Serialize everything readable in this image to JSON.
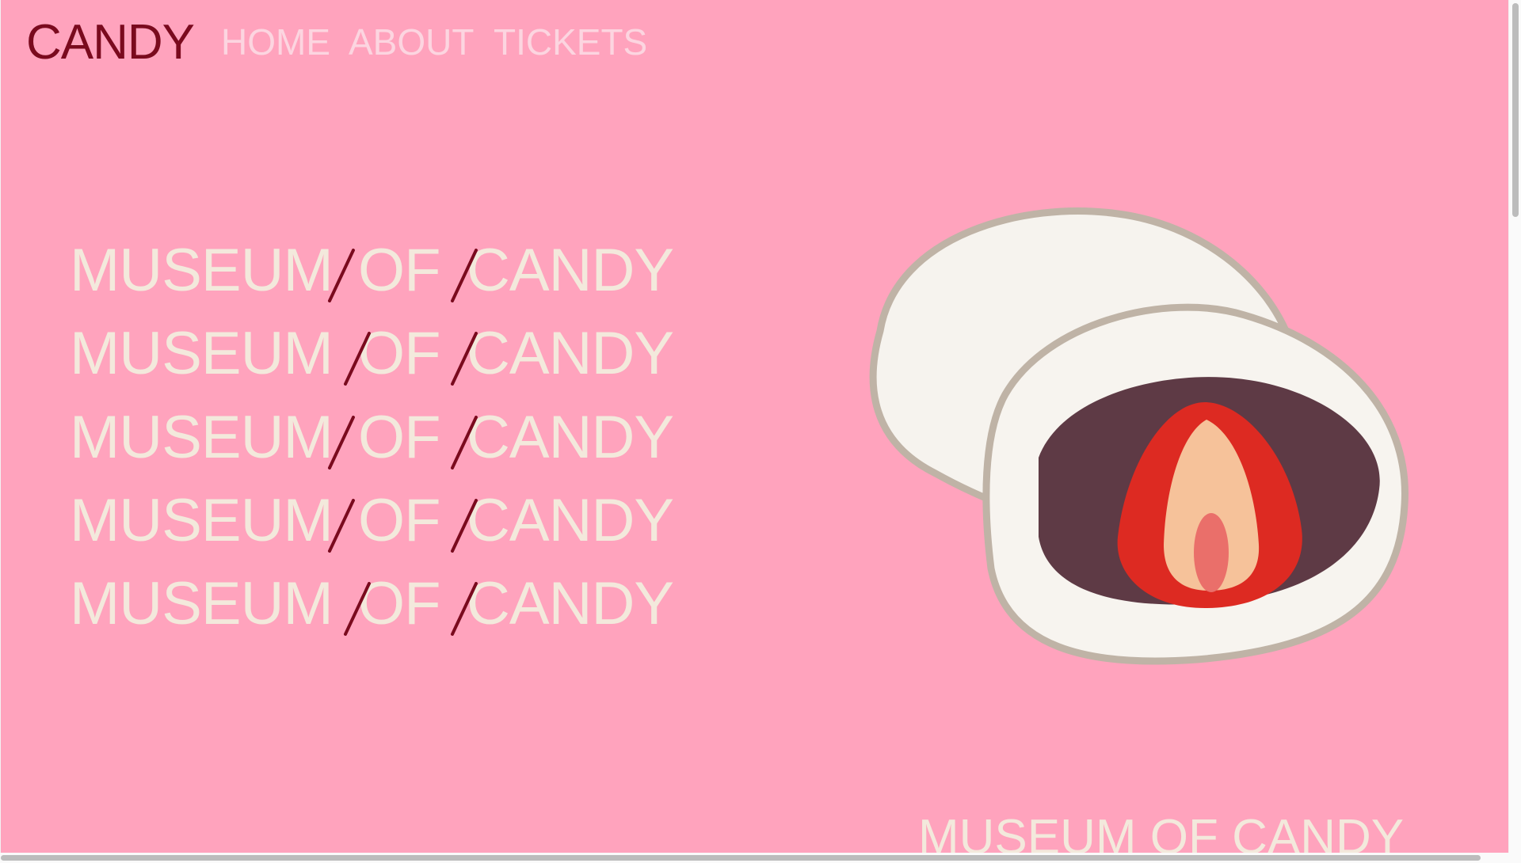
{
  "header": {
    "logo": "CANDY",
    "nav": [
      {
        "label": "HOME"
      },
      {
        "label": "ABOUT"
      },
      {
        "label": "TICKETS"
      }
    ]
  },
  "hero": {
    "lines": [
      {
        "words": [
          "MUSEUM",
          "OF",
          "CANDY"
        ],
        "slash": "/"
      },
      {
        "words": [
          "MUSEUM",
          "OF",
          "CANDY"
        ],
        "slash": "/"
      },
      {
        "words": [
          "MUSEUM",
          "OF",
          "CANDY"
        ],
        "slash": "/"
      },
      {
        "words": [
          "MUSEUM",
          "OF",
          "CANDY"
        ],
        "slash": "/"
      },
      {
        "words": [
          "MUSEUM",
          "OF",
          "CANDY"
        ],
        "slash": "/"
      }
    ],
    "image": "strawberry-daifuku-illustration"
  },
  "footer_title": "MUSEUM OF CANDY",
  "colors": {
    "background": "#ffa3bd",
    "logo": "#7a0a1e",
    "nav": "#fcd5e0",
    "hero_text": "#f3e9dc",
    "slash": "#7a0a1e"
  }
}
